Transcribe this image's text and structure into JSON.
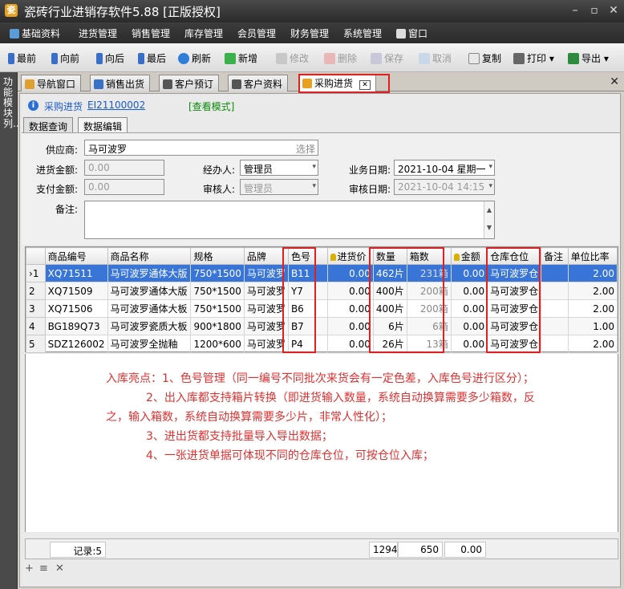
{
  "window": {
    "title": "瓷砖行业进销存软件5.88 [正版授权]",
    "app_icon": "app-icon"
  },
  "menu": {
    "items": [
      "基础资料",
      "进货管理",
      "销售管理",
      "库存管理",
      "会员管理",
      "财务管理",
      "系统管理",
      "窗口"
    ]
  },
  "toolbar": {
    "buttons": [
      {
        "label": "最前",
        "icon": "first-icon",
        "enabled": true
      },
      {
        "label": "向前",
        "icon": "prev-icon",
        "enabled": true
      },
      {
        "label": "向后",
        "icon": "next-icon",
        "enabled": true
      },
      {
        "label": "最后",
        "icon": "last-icon",
        "enabled": true
      },
      {
        "label": "刷新",
        "icon": "refresh-icon",
        "enabled": true
      },
      {
        "label": "新增",
        "icon": "add-icon",
        "enabled": true
      },
      {
        "label": "修改",
        "icon": "edit-icon",
        "enabled": false
      },
      {
        "label": "删除",
        "icon": "delete-icon",
        "enabled": false
      },
      {
        "label": "保存",
        "icon": "save-icon",
        "enabled": false
      },
      {
        "label": "取消",
        "icon": "cancel-icon",
        "enabled": false
      },
      {
        "label": "复制",
        "icon": "copy-icon",
        "enabled": true
      },
      {
        "label": "打印",
        "icon": "print-icon",
        "enabled": true
      },
      {
        "label": "导出",
        "icon": "export-icon",
        "enabled": true
      }
    ]
  },
  "sidebar": {
    "label": "功能模块列..."
  },
  "tabs": [
    {
      "label": "导航窗口",
      "icon": "home-icon"
    },
    {
      "label": "销售出货",
      "icon": "chart-icon"
    },
    {
      "label": "客户预订",
      "icon": "calendar-icon"
    },
    {
      "label": "客户资料",
      "icon": "contact-icon"
    },
    {
      "label": "采购进货",
      "icon": "clipboard-icon",
      "active": true
    }
  ],
  "doc": {
    "type_label": "采购进货",
    "number": "EI21100002",
    "mode": "[查看模式]"
  },
  "subtabs": [
    "数据查询",
    "数据编辑"
  ],
  "form": {
    "supplier_label": "供应商:",
    "supplier_value": "马可波罗",
    "supplier_button": "选择",
    "in_amount_label": "进货金额:",
    "in_amount_value": "0.00",
    "handler_label": "经办人:",
    "handler_value": "管理员",
    "biz_date_label": "业务日期:",
    "biz_date_value": "2021-10-04 星期一",
    "pay_amount_label": "支付金额:",
    "pay_amount_value": "0.00",
    "reviewer_label": "审核人:",
    "reviewer_value": "管理员",
    "review_date_label": "审核日期:",
    "review_date_value": "2021-10-04 14:15",
    "remark_label": "备注:",
    "remark_value": ""
  },
  "grid": {
    "headers": [
      "",
      "商品编号",
      "商品名称",
      "规格",
      "品牌",
      "色号",
      "进货价",
      "数量",
      "箱数",
      "金额",
      "仓库仓位",
      "备注",
      "单位比率"
    ],
    "rows": [
      {
        "idx": "1",
        "code": "XQ71511",
        "name": "马可波罗通体大版",
        "spec": "750*1500",
        "brand": "马可波罗",
        "color": "B11",
        "price": "0.00",
        "qty": "462片",
        "boxes": "231箱",
        "amount": "0.00",
        "warehouse": "马可波罗仓",
        "note": "",
        "ratio": "2.00"
      },
      {
        "idx": "2",
        "code": "XQ71509",
        "name": "马可波罗通体大版",
        "spec": "750*1500",
        "brand": "马可波罗",
        "color": "Y7",
        "price": "0.00",
        "qty": "400片",
        "boxes": "200箱",
        "amount": "0.00",
        "warehouse": "马可波罗仓",
        "note": "",
        "ratio": "2.00"
      },
      {
        "idx": "3",
        "code": "XQ71506",
        "name": "马可波罗通体大板",
        "spec": "750*1500",
        "brand": "马可波罗",
        "color": "B6",
        "price": "0.00",
        "qty": "400片",
        "boxes": "200箱",
        "amount": "0.00",
        "warehouse": "马可波罗仓",
        "note": "",
        "ratio": "2.00"
      },
      {
        "idx": "4",
        "code": "BG189Q73",
        "name": "马可波罗瓷质大板",
        "spec": "900*1800",
        "brand": "马可波罗",
        "color": "B7",
        "price": "0.00",
        "qty": "6片",
        "boxes": "6箱",
        "amount": "0.00",
        "warehouse": "马可波罗仓",
        "note": "",
        "ratio": "1.00"
      },
      {
        "idx": "5",
        "code": "SDZ126002",
        "name": "马可波罗全抛釉",
        "spec": "1200*600",
        "brand": "马可波罗",
        "color": "P4",
        "price": "0.00",
        "qty": "26片",
        "boxes": "13箱",
        "amount": "0.00",
        "warehouse": "马可波罗仓",
        "note": "",
        "ratio": "2.00"
      }
    ]
  },
  "notes": [
    "入库亮点：1、色号管理（同一编号不同批次来货会有一定色差，入库色号进行区分）；",
    "2、出入库都支持箱片转换（即进货输入数量，系统自动换算需要多少箱数，反",
    "之，输入箱数，系统自动换算需要多少片，非常人性化）；",
    "3、进出货都支持批量导入导出数据；",
    "4、一张进货单据可体现不同的仓库仓位，可按仓位入库；"
  ],
  "footer": {
    "record_label": "记录:5",
    "qty_total": "1294",
    "box_total": "650",
    "amount_total": "0.00"
  },
  "colors": {
    "selected_row": "#3875d7",
    "highlight_box": "#e02020",
    "note_text": "#e03030"
  }
}
